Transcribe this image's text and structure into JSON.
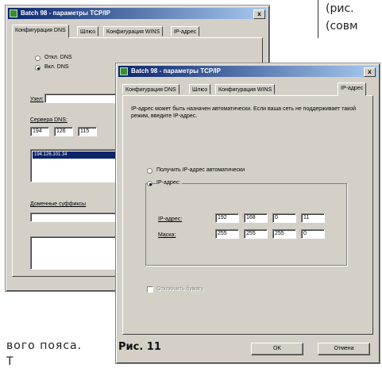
{
  "article": {
    "right_line1": "(рис.",
    "right_line2": "(совм",
    "left_line1": "вого  пояса.",
    "left_line2": "Т"
  },
  "caption": "Рис. 11",
  "back_window": {
    "title": "Batch 98 - параметры TCP/IP",
    "close_label": "x",
    "tabs": [
      "Конфигурация DNS",
      "Шлюз",
      "Конфигурация WINS",
      "IP-адрес"
    ],
    "radio_disable": "Откл. DNS",
    "radio_enable": "Вкл. DNS",
    "host_label": "Узел:",
    "host_value": "",
    "servers_label": "Сервера DNS:",
    "server_octets": [
      "194",
      "126",
      "115"
    ],
    "server_list_item": "194.126.101.34",
    "suffix_label": "Доменные суффиксы",
    "suffix_value": ""
  },
  "front_window": {
    "title": "Batch 98 - параметры TCP/IP",
    "close_label": "x",
    "tabs": [
      "Конфигурация DNS",
      "Шлюз",
      "Конфигурация WINS",
      "IP-адрес"
    ],
    "description": "IP-адрес может быть назначен автоматически. Если ваша сеть не поддерживает такой режим, введите IP-адрес.",
    "radio_auto": "Получить IP-адрес автоматически",
    "radio_manual": "IP-адрес:",
    "ip_label": "IP-адрес:",
    "ip_octets": [
      "192",
      "168",
      "0",
      "11"
    ],
    "mask_label": "Маска:",
    "mask_octets": [
      "255",
      "255",
      "255",
      "0"
    ],
    "checkbox_label": "Отключить бумагу",
    "ok_label": "OK",
    "cancel_label": "Отмена"
  }
}
